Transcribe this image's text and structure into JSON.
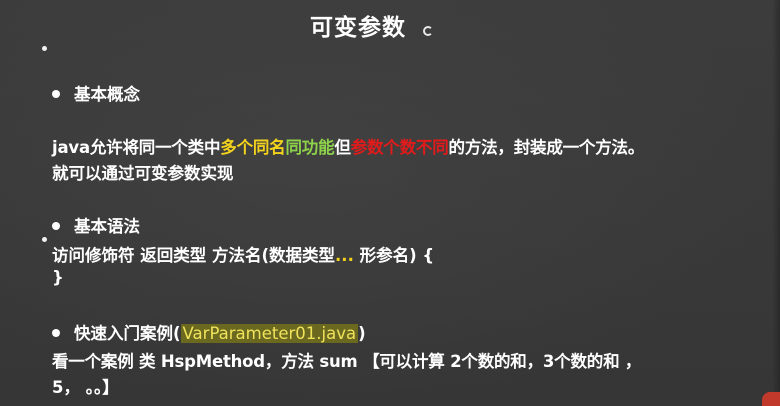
{
  "slide": {
    "title": "可变参数",
    "sections": {
      "concept": {
        "heading": "基本概念",
        "line1": {
          "p1": "java允许将同一个类中",
          "p2": "多个同名",
          "p3": "同功能",
          "p4": "但",
          "p5": "参数个数不同",
          "p6": "的方法，封装成一个方法。"
        },
        "line2": "就可以通过可变参数实现"
      },
      "syntax": {
        "heading": "基本语法",
        "line1_a": "访问修饰符 返回类型 方法名(数据类型",
        "line1_dots": "...",
        "line1_b": " 形参名) {",
        "line2": "}"
      },
      "example": {
        "heading_prefix": "快速入门案例(",
        "heading_file": "VarParameter01.java",
        "heading_suffix": ")",
        "line1": "看一个案例 类 HspMethod，方法 sum  【可以计算 2个数的和，3个数的和 ，",
        "line2": "5，   。。】"
      }
    },
    "colors": {
      "background": "#3b3b3b",
      "text": "#ffffff",
      "highlight_yellow": "#f3d21c",
      "highlight_green": "#8ed24a",
      "highlight_red": "#e11b1b"
    }
  }
}
